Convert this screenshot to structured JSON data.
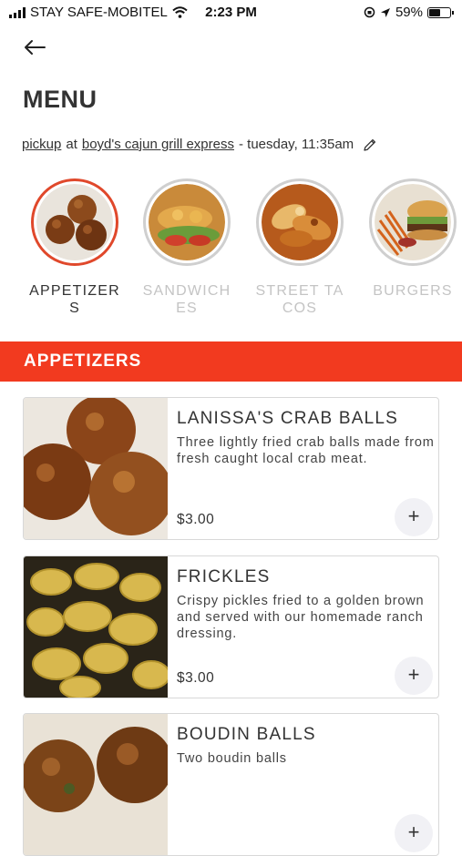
{
  "status_bar": {
    "carrier": "STAY SAFE-MOBITEL",
    "time": "2:23 PM",
    "battery": "59%",
    "battery_level": 0.59,
    "icons": [
      "signal-icon",
      "wifi-icon",
      "screen-lock-icon",
      "location-arrow-icon",
      "battery-icon"
    ]
  },
  "header": {
    "back_icon": "arrow-left-icon",
    "title": "MENU"
  },
  "context": {
    "mode": "pickup",
    "at": "at",
    "location": "boyd's cajun grill express",
    "datetime": "- tuesday, 11:35am",
    "edit_icon": "pencil-icon"
  },
  "categories": [
    {
      "label": "APPETIZERS",
      "active": true
    },
    {
      "label": "SANDWICHES",
      "active": false
    },
    {
      "label": "STREET TACOS",
      "active": false
    },
    {
      "label": "BURGERS",
      "active": false
    }
  ],
  "section": {
    "title": "APPETIZERS"
  },
  "items": [
    {
      "name": "LANISSA'S CRAB BALLS",
      "description": "Three lightly fried crab balls made from fresh caught local crab meat.",
      "price": "$3.00",
      "add": "+"
    },
    {
      "name": "FRICKLES",
      "description": "Crispy pickles fried to a golden brown and served with our homemade ranch dressing.",
      "price": "$3.00",
      "add": "+"
    },
    {
      "name": "BOUDIN BALLS",
      "description": "Two boudin balls",
      "price": "",
      "add": "+"
    }
  ],
  "colors": {
    "accent": "#f23a1f",
    "active_ring": "#e0482b",
    "inactive_text": "#c4c4c4"
  }
}
